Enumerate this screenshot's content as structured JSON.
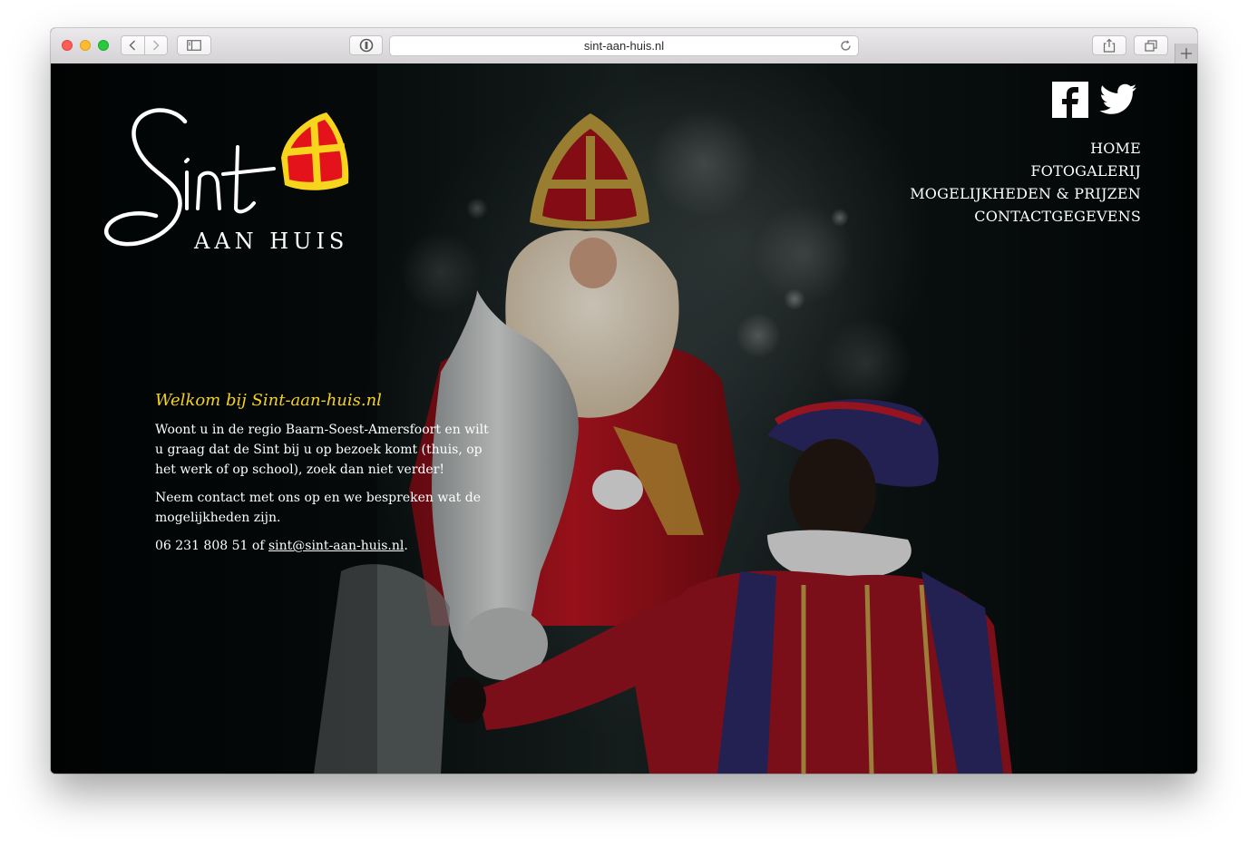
{
  "browser": {
    "url": "sint-aan-huis.nl",
    "back_icon": "chevron-left-icon",
    "forward_icon": "chevron-right-icon",
    "sidebar_icon": "sidebar-icon",
    "reader_icon": "reader-icon",
    "reload_icon": "reload-icon",
    "share_icon": "share-icon",
    "tabs_icon": "tabs-icon",
    "new_tab_icon": "plus-icon"
  },
  "logo": {
    "script_text": "Sint",
    "subtitle": "AAN HUIS",
    "colors": {
      "mitre_gold": "#f7d51d",
      "mitre_red": "#e3121b"
    }
  },
  "social": {
    "facebook_icon": "facebook-icon",
    "twitter_icon": "twitter-icon"
  },
  "nav": {
    "items": [
      {
        "label": "HOME"
      },
      {
        "label": "FOTOGALERIJ"
      },
      {
        "label": "MOGELIJKHEDEN & PRIJZEN"
      },
      {
        "label": "CONTACTGEGEVENS"
      }
    ]
  },
  "intro": {
    "heading": "Welkom bij Sint-aan-huis.nl",
    "paragraph1": "Woont u in de regio Baarn-Soest-Amersfoort en wilt u graag dat de Sint bij u op bezoek komt (thuis, op het werk of op school), zoek dan niet verder!",
    "paragraph2": "Neem contact met ons op en we bespreken wat de mogelijkheden zijn.",
    "phone": "06 231 808 51",
    "connector": " of ",
    "email": "sint@sint-aan-huis.nl",
    "end": "."
  },
  "theme": {
    "heading_color": "#f5d21b",
    "text_color": "#ffffff",
    "background": "#050909"
  }
}
